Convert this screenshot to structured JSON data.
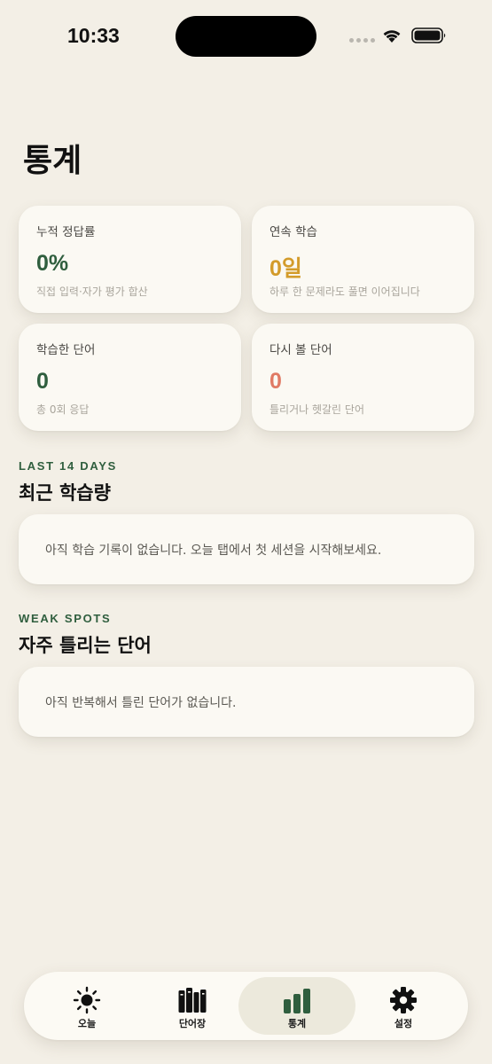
{
  "status_bar": {
    "time": "10:33"
  },
  "page": {
    "title": "통계"
  },
  "stats": [
    {
      "label": "누적 정답률",
      "value": "0%",
      "sub": "직접 입력·자가 평가 합산",
      "value_color": "#2F5E3E"
    },
    {
      "label": "연속 학습",
      "value": "0일",
      "sub": "하루 한 문제라도 풀면 이어집니다",
      "value_color": "#D39B2A"
    },
    {
      "label": "학습한 단어",
      "value": "0",
      "sub": "총 0회 응답",
      "value_color": "#2F5E3E"
    },
    {
      "label": "다시 볼 단어",
      "value": "0",
      "sub": "틀리거나 헷갈린 단어",
      "value_color": "#E07A64"
    }
  ],
  "recent": {
    "eyebrow": "LAST 14 DAYS",
    "title": "최근 학습량",
    "empty_text": "아직 학습 기록이 없습니다. 오늘 탭에서 첫 세션을 시작해보세요."
  },
  "weak": {
    "eyebrow": "WEAK SPOTS",
    "title": "자주 틀리는 단어",
    "empty_text": "아직 반복해서 틀린 단어가 없습니다."
  },
  "tab_bar": {
    "active": "stats",
    "tabs": [
      {
        "key": "today",
        "label": "오늘",
        "icon": "sun-icon"
      },
      {
        "key": "wordbook",
        "label": "단어장",
        "icon": "books-icon"
      },
      {
        "key": "stats",
        "label": "통계",
        "icon": "bar-chart-icon"
      },
      {
        "key": "settings",
        "label": "설정",
        "icon": "gear-icon"
      }
    ]
  }
}
